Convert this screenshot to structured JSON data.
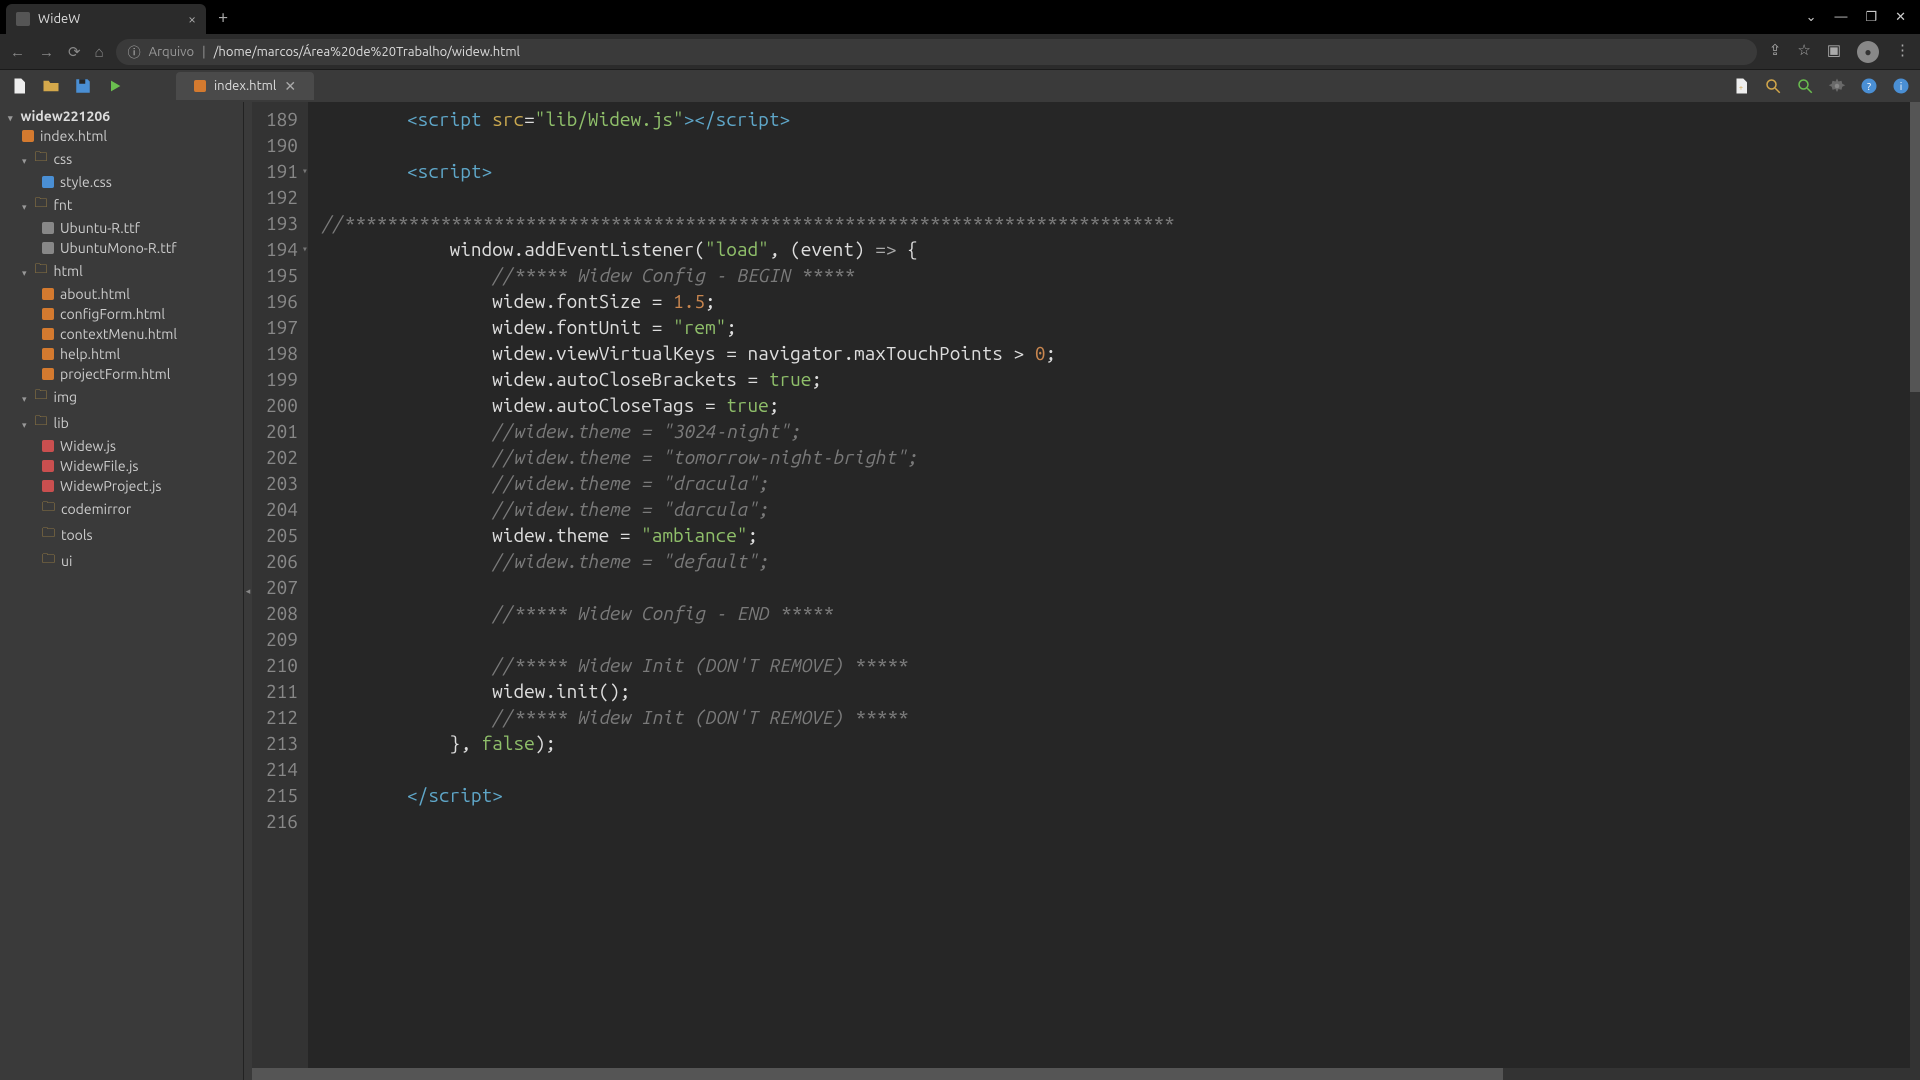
{
  "browser": {
    "tab_title": "WideW",
    "url_proto": "Arquivo",
    "url_path": "/home/marcos/Área%20de%20Trabalho/widew.html"
  },
  "toolbar": {
    "file_tab": "index.html"
  },
  "sidebar": {
    "root": "widew221206",
    "items": [
      {
        "name": "index.html",
        "type": "html",
        "indent": 1
      },
      {
        "name": "css",
        "type": "folder",
        "indent": 1
      },
      {
        "name": "style.css",
        "type": "css",
        "indent": 2
      },
      {
        "name": "fnt",
        "type": "folder",
        "indent": 1
      },
      {
        "name": "Ubuntu-R.ttf",
        "type": "ttf",
        "indent": 2
      },
      {
        "name": "UbuntuMono-R.ttf",
        "type": "ttf",
        "indent": 2
      },
      {
        "name": "html",
        "type": "folder",
        "indent": 1
      },
      {
        "name": "about.html",
        "type": "html",
        "indent": 2
      },
      {
        "name": "configForm.html",
        "type": "html",
        "indent": 2
      },
      {
        "name": "contextMenu.html",
        "type": "html",
        "indent": 2
      },
      {
        "name": "help.html",
        "type": "html",
        "indent": 2
      },
      {
        "name": "projectForm.html",
        "type": "html",
        "indent": 2
      },
      {
        "name": "img",
        "type": "folder",
        "indent": 1
      },
      {
        "name": "lib",
        "type": "folder",
        "indent": 1
      },
      {
        "name": "Widew.js",
        "type": "js",
        "indent": 2
      },
      {
        "name": "WidewFile.js",
        "type": "js",
        "indent": 2
      },
      {
        "name": "WidewProject.js",
        "type": "js",
        "indent": 2
      },
      {
        "name": "codemirror",
        "type": "dir",
        "indent": 2
      },
      {
        "name": "tools",
        "type": "dir",
        "indent": 2
      },
      {
        "name": "ui",
        "type": "dir",
        "indent": 2
      }
    ]
  },
  "editor": {
    "first_line": 189,
    "lines": [
      {
        "n": 189,
        "html": "        <span class='tok-tag'>&lt;script</span> <span class='tok-attr'>src</span>=<span class='tok-str'>\"lib/Widew.js\"</span><span class='tok-tag'>&gt;&lt;/script&gt;</span>"
      },
      {
        "n": 190,
        "html": ""
      },
      {
        "n": 191,
        "fold": true,
        "html": "        <span class='tok-tag'>&lt;script&gt;</span>"
      },
      {
        "n": 192,
        "html": ""
      },
      {
        "n": 193,
        "html": "<span class='tok-comment'>//******************************************************************************</span>"
      },
      {
        "n": 194,
        "fold": true,
        "html": "            <span class='tok-ident'>window</span>.<span class='tok-prop'>addEventListener</span>(<span class='tok-str'>\"load\"</span>, (<span class='tok-ident'>event</span>) <span class='tok-punc'>=&gt;</span> {"
      },
      {
        "n": 195,
        "html": "                <span class='tok-comment'>//***** Widew Config - BEGIN *****</span>"
      },
      {
        "n": 196,
        "html": "                <span class='tok-ident'>widew</span>.<span class='tok-prop'>fontSize</span> = <span class='tok-num'>1.5</span>;"
      },
      {
        "n": 197,
        "html": "                <span class='tok-ident'>widew</span>.<span class='tok-prop'>fontUnit</span> = <span class='tok-str'>\"rem\"</span>;"
      },
      {
        "n": 198,
        "html": "                <span class='tok-ident'>widew</span>.<span class='tok-prop'>viewVirtualKeys</span> = <span class='tok-ident'>navigator</span>.<span class='tok-prop'>maxTouchPoints</span> &gt; <span class='tok-num'>0</span>;"
      },
      {
        "n": 199,
        "html": "                <span class='tok-ident'>widew</span>.<span class='tok-prop'>autoCloseBrackets</span> = <span class='tok-kw'>true</span>;"
      },
      {
        "n": 200,
        "html": "                <span class='tok-ident'>widew</span>.<span class='tok-prop'>autoCloseTags</span> = <span class='tok-kw'>true</span>;"
      },
      {
        "n": 201,
        "html": "                <span class='tok-comment'>//widew.theme = \"3024-night\";</span>"
      },
      {
        "n": 202,
        "html": "                <span class='tok-comment'>//widew.theme = \"tomorrow-night-bright\";</span>"
      },
      {
        "n": 203,
        "html": "                <span class='tok-comment'>//widew.theme = \"dracula\";</span>"
      },
      {
        "n": 204,
        "html": "                <span class='tok-comment'>//widew.theme = \"darcula\";</span>"
      },
      {
        "n": 205,
        "html": "                <span class='tok-ident'>widew</span>.<span class='tok-prop'>theme</span> = <span class='tok-str'>\"ambiance\"</span>;"
      },
      {
        "n": 206,
        "html": "                <span class='tok-comment'>//widew.theme = \"default\";</span>"
      },
      {
        "n": 207,
        "html": ""
      },
      {
        "n": 208,
        "html": "                <span class='tok-comment'>//***** Widew Config - END *****</span>"
      },
      {
        "n": 209,
        "html": ""
      },
      {
        "n": 210,
        "html": "                <span class='tok-comment'>//***** Widew Init (DON'T REMOVE) *****</span>"
      },
      {
        "n": 211,
        "html": "                <span class='tok-ident'>widew</span>.<span class='tok-prop'>init</span>();"
      },
      {
        "n": 212,
        "html": "                <span class='tok-comment'>//***** Widew Init (DON'T REMOVE) *****</span>"
      },
      {
        "n": 213,
        "html": "            }, <span class='tok-kw'>false</span>);"
      },
      {
        "n": 214,
        "html": ""
      },
      {
        "n": 215,
        "html": "        <span class='tok-tag'>&lt;/script&gt;</span>"
      },
      {
        "n": 216,
        "html": ""
      }
    ]
  }
}
